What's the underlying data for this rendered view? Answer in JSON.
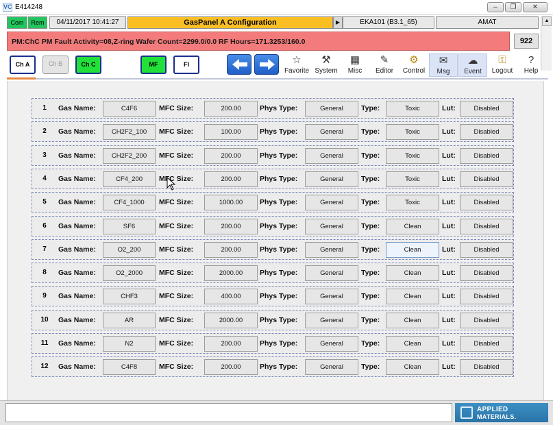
{
  "window": {
    "title": "E414248",
    "app_icon": "VC"
  },
  "status": {
    "com": "Com",
    "rem": "Rem",
    "datetime": "04/11/2017 10:41:27",
    "panel_title": "GasPanel A  Configuration",
    "tool_id": "EKA101 (B3.1_65)",
    "vendor": "AMAT"
  },
  "fault": {
    "message": "PM:ChC PM Fault Activity=08,Z-ring Wafer Count=2299.0/0.0 RF Hours=171.3253/160.0",
    "count": "922"
  },
  "toolbar": {
    "chambers": [
      "Ch A",
      "Ch B",
      "Ch C"
    ],
    "mf": "MF",
    "fi": "FI",
    "tools": [
      {
        "label": "Favorite",
        "icon": "star-icon"
      },
      {
        "label": "System",
        "icon": "tools-icon"
      },
      {
        "label": "Misc",
        "icon": "misc-icon"
      },
      {
        "label": "Editor",
        "icon": "editor-icon"
      },
      {
        "label": "Control",
        "icon": "control-icon"
      },
      {
        "label": "Msg",
        "icon": "message-icon"
      },
      {
        "label": "Event",
        "icon": "event-icon"
      },
      {
        "label": "Logout",
        "icon": "key-icon"
      },
      {
        "label": "Help",
        "icon": "help-icon"
      }
    ]
  },
  "labels": {
    "gas_name": "Gas Name:",
    "mfc_size": "MFC Size:",
    "phys_type": "Phys Type:",
    "type": "Type:",
    "lut": "Lut:"
  },
  "gases": [
    {
      "num": "1",
      "name": "C4F6",
      "mfc": "200.00",
      "phys": "General",
      "type": "Toxic",
      "lut": "Disabled"
    },
    {
      "num": "2",
      "name": "CH2F2_100",
      "mfc": "100.00",
      "phys": "General",
      "type": "Toxic",
      "lut": "Disabled"
    },
    {
      "num": "3",
      "name": "CH2F2_200",
      "mfc": "200.00",
      "phys": "General",
      "type": "Toxic",
      "lut": "Disabled"
    },
    {
      "num": "4",
      "name": "CF4_200",
      "mfc": "200.00",
      "phys": "General",
      "type": "Toxic",
      "lut": "Disabled"
    },
    {
      "num": "5",
      "name": "CF4_1000",
      "mfc": "1000.00",
      "phys": "General",
      "type": "Toxic",
      "lut": "Disabled"
    },
    {
      "num": "6",
      "name": "SF6",
      "mfc": "200.00",
      "phys": "General",
      "type": "Clean",
      "lut": "Disabled"
    },
    {
      "num": "7",
      "name": "O2_200",
      "mfc": "200.00",
      "phys": "General",
      "type": "Clean",
      "lut": "Disabled"
    },
    {
      "num": "8",
      "name": "O2_2000",
      "mfc": "2000.00",
      "phys": "General",
      "type": "Clean",
      "lut": "Disabled"
    },
    {
      "num": "9",
      "name": "CHF3",
      "mfc": "400.00",
      "phys": "General",
      "type": "Clean",
      "lut": "Disabled"
    },
    {
      "num": "10",
      "name": "AR",
      "mfc": "2000.00",
      "phys": "General",
      "type": "Clean",
      "lut": "Disabled"
    },
    {
      "num": "11",
      "name": "N2",
      "mfc": "200.00",
      "phys": "General",
      "type": "Clean",
      "lut": "Disabled"
    },
    {
      "num": "12",
      "name": "C4F8",
      "mfc": "200.00",
      "phys": "General",
      "type": "Clean",
      "lut": "Disabled"
    }
  ],
  "footer": {
    "logo_line1": "APPLIED",
    "logo_line2": "MATERIALS."
  }
}
